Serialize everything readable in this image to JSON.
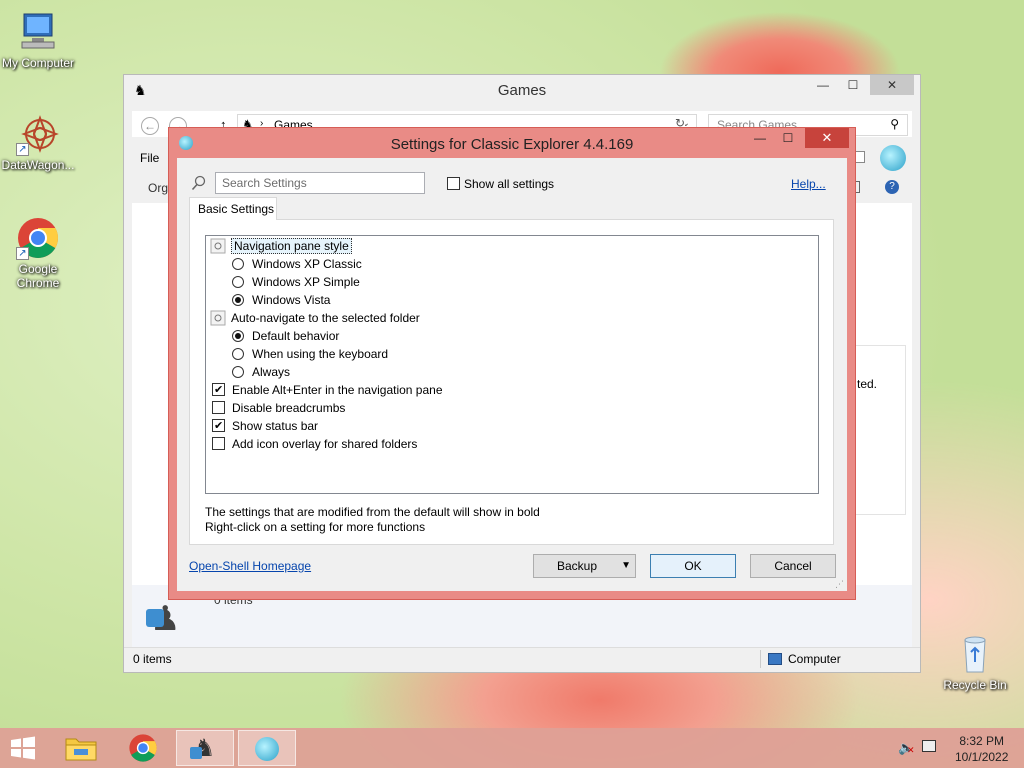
{
  "desktop": {
    "icons": [
      {
        "label": "My Computer"
      },
      {
        "label": "DataWagon..."
      },
      {
        "label": "Google Chrome"
      },
      {
        "label": "Recycle Bin"
      }
    ]
  },
  "explorer": {
    "title": "Games",
    "address": "Games",
    "search_placeholder": "Search Games",
    "file_menu": "File",
    "organize": "Org",
    "details_items": "0 items",
    "partial_text": "ted.",
    "status_items": "0 items",
    "status_location": "Computer"
  },
  "dialog": {
    "title": "Settings for Classic Explorer 4.4.169",
    "search_placeholder": "Search Settings",
    "show_all_label": "Show all settings",
    "show_all_checked": false,
    "help_label": "Help...",
    "tab_label": "Basic Settings",
    "tree": [
      {
        "kind": "group",
        "label": "Navigation pane style"
      },
      {
        "kind": "radio",
        "label": "Windows XP Classic",
        "checked": false
      },
      {
        "kind": "radio",
        "label": "Windows XP Simple",
        "checked": false
      },
      {
        "kind": "radio",
        "label": "Windows Vista",
        "checked": true
      },
      {
        "kind": "group",
        "label": "Auto-navigate to the selected folder"
      },
      {
        "kind": "radio",
        "label": "Default behavior",
        "checked": true
      },
      {
        "kind": "radio",
        "label": "When using the keyboard",
        "checked": false
      },
      {
        "kind": "radio",
        "label": "Always",
        "checked": false
      },
      {
        "kind": "check",
        "label": "Enable Alt+Enter in the navigation pane",
        "checked": true
      },
      {
        "kind": "check",
        "label": "Disable breadcrumbs",
        "checked": false
      },
      {
        "kind": "check",
        "label": "Show status bar",
        "checked": true
      },
      {
        "kind": "check",
        "label": "Add icon overlay for shared folders",
        "checked": false
      }
    ],
    "note_line1": "The settings that are modified from the default will show in bold",
    "note_line2": "Right-click on a setting for more functions",
    "homepage_link": "Open-Shell Homepage",
    "backup_label": "Backup",
    "ok_label": "OK",
    "cancel_label": "Cancel"
  },
  "taskbar": {
    "time": "8:32 PM",
    "date": "10/1/2022"
  },
  "colors": {
    "dialog_frame": "#e98b86",
    "dialog_close": "#c7433c",
    "taskbar": "#dea096",
    "link": "#0645ad"
  }
}
